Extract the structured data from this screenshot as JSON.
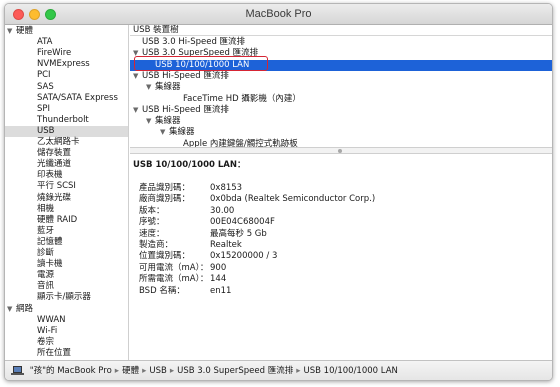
{
  "window": {
    "title": "MacBook Pro"
  },
  "sidebar": {
    "items": [
      {
        "label": "硬體",
        "level": 0,
        "expanded": true
      },
      {
        "label": "ATA",
        "level": 1
      },
      {
        "label": "FireWire",
        "level": 1
      },
      {
        "label": "NVMExpress",
        "level": 1
      },
      {
        "label": "PCI",
        "level": 1
      },
      {
        "label": "SAS",
        "level": 1
      },
      {
        "label": "SATA/SATA Express",
        "level": 1
      },
      {
        "label": "SPI",
        "level": 1
      },
      {
        "label": "Thunderbolt",
        "level": 1
      },
      {
        "label": "USB",
        "level": 1,
        "selected": true
      },
      {
        "label": "乙太網路卡",
        "level": 1
      },
      {
        "label": "儲存裝置",
        "level": 1
      },
      {
        "label": "光纖通道",
        "level": 1
      },
      {
        "label": "印表機",
        "level": 1
      },
      {
        "label": "平行 SCSI",
        "level": 1
      },
      {
        "label": "燒錄光碟",
        "level": 1
      },
      {
        "label": "相機",
        "level": 1
      },
      {
        "label": "硬體 RAID",
        "level": 1
      },
      {
        "label": "藍牙",
        "level": 1
      },
      {
        "label": "記憶體",
        "level": 1
      },
      {
        "label": "診斷",
        "level": 1
      },
      {
        "label": "讀卡機",
        "level": 1
      },
      {
        "label": "電源",
        "level": 1
      },
      {
        "label": "音訊",
        "level": 1
      },
      {
        "label": "顯示卡/顯示器",
        "level": 1
      },
      {
        "label": "網路",
        "level": 0,
        "expanded": true
      },
      {
        "label": "WWAN",
        "level": 1
      },
      {
        "label": "Wi-Fi",
        "level": 1
      },
      {
        "label": "卷宗",
        "level": 1
      },
      {
        "label": "所在位置",
        "level": 1
      }
    ]
  },
  "tree": {
    "header": "USB 裝置樹",
    "rows": [
      {
        "label": "USB 3.0 Hi-Speed 匯流排",
        "indent": 0,
        "arrow": ""
      },
      {
        "label": "USB 3.0 SuperSpeed 匯流排",
        "indent": 0,
        "arrow": "▼"
      },
      {
        "label": "USB 10/100/1000 LAN",
        "indent": 1,
        "arrow": "",
        "selected": true
      },
      {
        "label": "USB Hi-Speed 匯流排",
        "indent": 0,
        "arrow": "▼"
      },
      {
        "label": "集線器",
        "indent": 1,
        "arrow": "▼"
      },
      {
        "label": "FaceTime HD 攝影機（內建）",
        "indent": 3,
        "arrow": ""
      },
      {
        "label": "USB Hi-Speed 匯流排",
        "indent": 0,
        "arrow": "▼"
      },
      {
        "label": "集線器",
        "indent": 1,
        "arrow": "▼"
      },
      {
        "label": "集線器",
        "indent": 2,
        "arrow": "▼"
      },
      {
        "label": "Apple 內建鍵盤/觸控式軌跡板",
        "indent": 3,
        "arrow": ""
      }
    ]
  },
  "detail": {
    "title": "USB 10/100/1000 LAN：",
    "fields": [
      {
        "key": "產品識別碼：",
        "value": "0x8153"
      },
      {
        "key": "廠商識別碼：",
        "value": "0x0bda  (Realtek Semiconductor Corp.)"
      },
      {
        "key": "版本：",
        "value": "30.00"
      },
      {
        "key": "序號：",
        "value": "00E04C68004F"
      },
      {
        "key": "速度：",
        "value": "最高每秒 5 Gb"
      },
      {
        "key": "製造商：",
        "value": "Realtek"
      },
      {
        "key": "位置識別碼：",
        "value": "0x15200000 / 3"
      },
      {
        "key": "可用電流（mA）：",
        "value": "900"
      },
      {
        "key": "所需電流（mA）：",
        "value": "144"
      },
      {
        "key": "BSD 名稱：",
        "value": "en11"
      }
    ]
  },
  "statusbar": {
    "crumbs": [
      "\"孩\"的 MacBook Pro",
      "硬體",
      "USB",
      "USB 3.0 SuperSpeed 匯流排",
      "USB 10/100/1000 LAN"
    ],
    "separator": "▸"
  }
}
